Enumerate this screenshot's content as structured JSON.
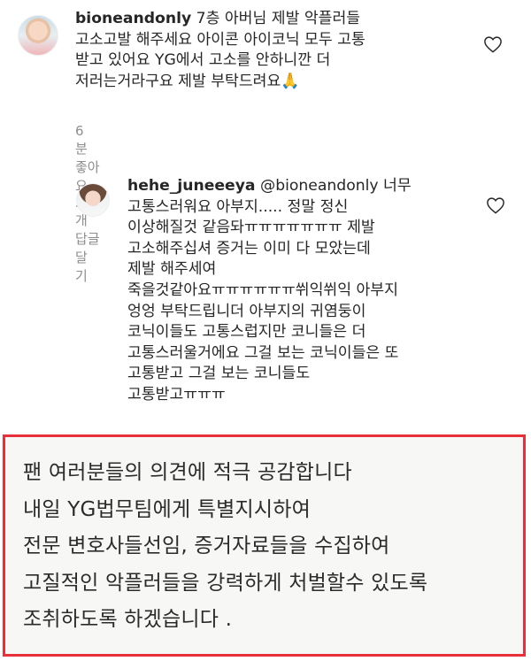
{
  "comments": [
    {
      "username": "bioneandonly",
      "text": " 7층 아버님 제발 악플러들\n고소고발 해주세요 아이콘 아이코닉 모두 고통\n받고  있어요 YG에서 고소를 안하니깐 더\n저러는거라구요 제발 부탁드려요",
      "emoji": "🙏",
      "meta": {
        "time": "6분",
        "likes": "좋아요 39개",
        "reply": "답글 달기"
      },
      "icon": "heart-outline-icon"
    },
    {
      "username": "hehe_juneeeya",
      "mention": "@bioneandonly",
      "text": " 너무\n고통스러워요 아부지..... 정말 정신\n이상해질것 같음돠ㅠㅠㅠㅠㅠㅠㅠ 제발\n고소해주십셔 증거는 이미 다 모았는데\n제발 해주세여\n죽을것같아요ㅠㅠㅠㅠㅠㅠ쒸익쒸익 아부지\n엉엉 부탁드립니더 아부지의 귀염둥이\n코닉이들도 고통스럽지만 코니들은 더\n고통스러울거에요 그걸 보는 코닉이들은 또\n고통받고 그걸 보는 코니들도\n고통받고ㅠㅠㅠ",
      "icon": "heart-outline-icon"
    }
  ],
  "notice": {
    "text": "팬 여러분들의 의견에 적극 공감합니다\n내일 YG법무팀에게 특별지시하여\n전문 변호사들선임, 증거자료들을 수집하여\n고질적인 악플러들을 강력하게 처벌할수 있도록\n조취하도록 하겠습니다 ."
  }
}
